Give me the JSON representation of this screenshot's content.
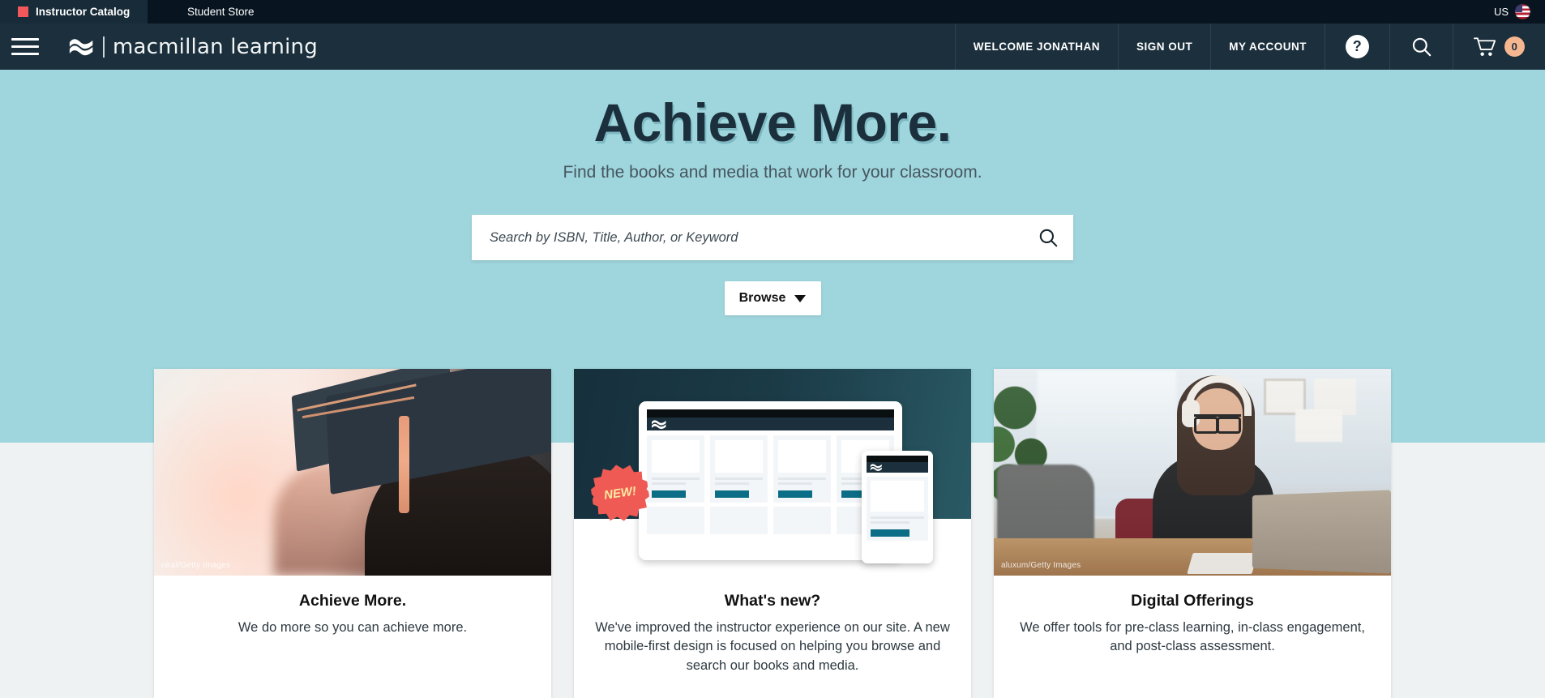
{
  "topbar": {
    "tabs": [
      {
        "label": "Instructor Catalog",
        "active": true,
        "marker_color": "#f2585b"
      },
      {
        "label": "Student Store",
        "active": false
      }
    ],
    "locale": {
      "label": "US",
      "icon": "us-flag-icon"
    }
  },
  "header": {
    "menu_icon": "hamburger-menu-icon",
    "logo": {
      "mark": "macmillan-wave-logo",
      "text": "macmillan learning"
    },
    "nav": [
      {
        "label": "WELCOME JONATHAN",
        "name": "welcome-user"
      },
      {
        "label": "SIGN OUT",
        "name": "sign-out"
      },
      {
        "label": "MY ACCOUNT",
        "name": "my-account"
      }
    ],
    "help_label": "?",
    "cart_count": "0",
    "bg_color": "#1b2f3c"
  },
  "hero": {
    "title": "Achieve More.",
    "subtitle": "Find the books and media that work for your classroom.",
    "bg_color": "#9fd6dd",
    "search": {
      "value": "",
      "placeholder": "Search by ISBN, Title, Author, or Keyword",
      "icon": "search-icon"
    },
    "browse_label": "Browse"
  },
  "cards": [
    {
      "name": "achieve-more",
      "title": "Achieve More.",
      "text": "We do more so you can achieve more.",
      "credit": "nirat/Getty Images",
      "badge": null
    },
    {
      "name": "whats-new",
      "title": "What's new?",
      "text": "We've improved the instructor experience on our site. A new mobile-first design is focused on helping you browse and search our books and media.",
      "credit": null,
      "badge": "NEW!"
    },
    {
      "name": "digital-offerings",
      "title": "Digital Offerings",
      "text": "We offer tools for pre-class learning, in-class engagement, and post-class assessment.",
      "credit": "aluxum/Getty Images",
      "badge": null
    }
  ]
}
